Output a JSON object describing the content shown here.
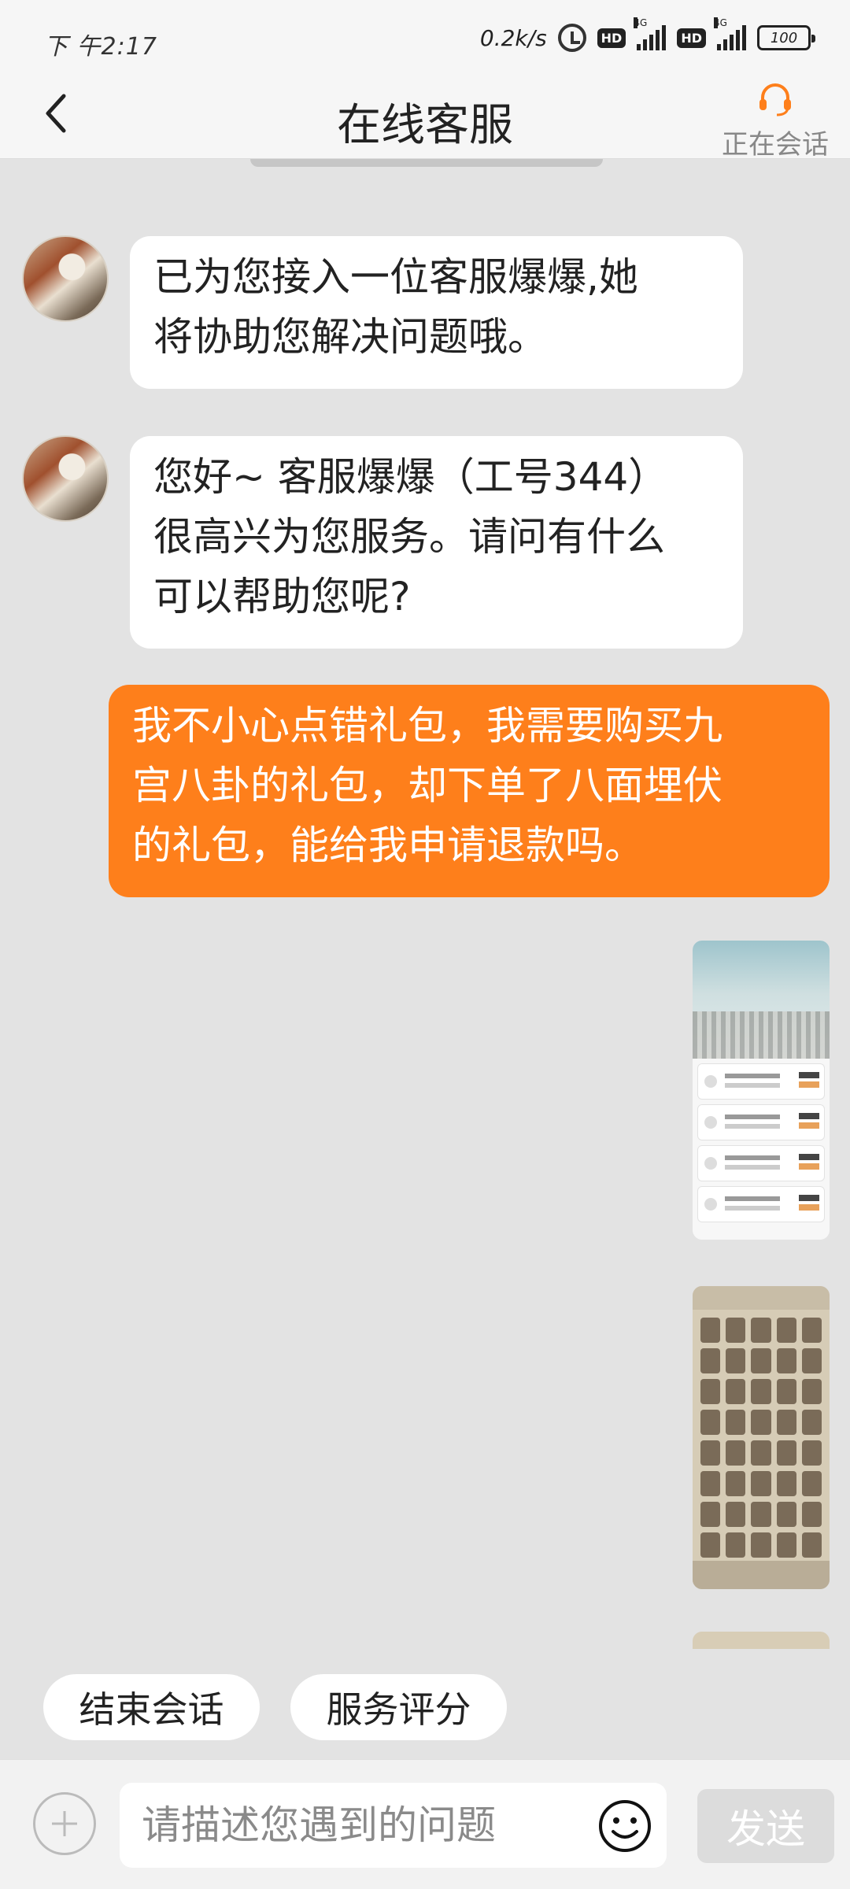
{
  "status_bar": {
    "time": "下 午2:17",
    "net_speed": "0.2k/s",
    "hd1": "HD",
    "hd2": "HD",
    "net_tag1": "4G",
    "net_tag2": "4G",
    "battery": "100"
  },
  "header": {
    "title": "在线客服",
    "status_label": "正在会话",
    "icons": {
      "back": "chevron-left-icon",
      "agent": "headset-icon"
    },
    "accent_color": "#fe7f1b"
  },
  "messages": [
    {
      "from": "agent",
      "text": "已为您接入一位客服爆爆,她\n将协助您解决问题哦。"
    },
    {
      "from": "agent",
      "text": "您好~ 客服爆爆（工号344）\n很高兴为您服务。请问有什么\n可以帮助您呢?"
    },
    {
      "from": "user",
      "text": "我不小心点错礼包，我需要购买九\n宫八卦的礼包，却下单了八面埋伏\n的礼包，能给我申请退款吗。"
    },
    {
      "from": "user",
      "type": "image",
      "description": "order-records-screenshot"
    },
    {
      "from": "user",
      "type": "image",
      "description": "backpack-screenshot"
    }
  ],
  "quick_actions": {
    "end_session": "结束会话",
    "rate_service": "服务评分"
  },
  "input": {
    "placeholder": "请描述您遇到的问题",
    "value": "",
    "send_label": "发送"
  }
}
